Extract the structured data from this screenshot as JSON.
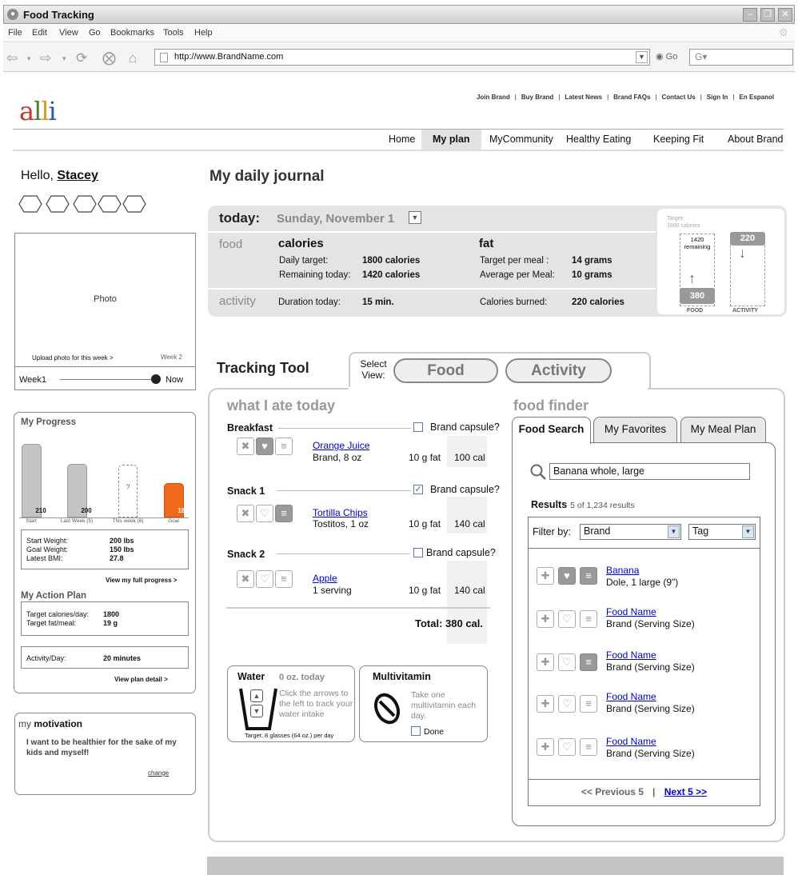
{
  "window": {
    "title": "Food Tracking"
  },
  "menu": [
    "File",
    "Edit",
    "View",
    "Go",
    "Bookmarks",
    "Tools",
    "Help"
  ],
  "browser": {
    "url": "http://www.BrandName.com",
    "go_label": "Go"
  },
  "header": {
    "logo": {
      "a": "a",
      "l1": "l",
      "l2": "l",
      "i": "i"
    },
    "top_links": [
      "Join Brand",
      "Buy Brand",
      "Latest News",
      "Brand FAQs",
      "Contact Us",
      "Sign In",
      "En Espanol"
    ],
    "nav": [
      "Home",
      "My plan",
      "MyCommunity",
      "Healthy Eating",
      "Keeping Fit",
      "About Brand"
    ]
  },
  "user": {
    "greeting": "Hello,",
    "name": "Stacey"
  },
  "photo": {
    "label": "Photo",
    "upload": "Upload photo for this week >",
    "week_end": "Week 2",
    "slider_start": "Week1",
    "slider_end": "Now",
    "slider_position": 1.0
  },
  "progress": {
    "title": "My Progress",
    "bars": [
      {
        "value": "210",
        "caption": "Start"
      },
      {
        "value": "200",
        "caption": "Last Week (5)"
      },
      {
        "value": "?",
        "caption": "This week (6)"
      },
      {
        "value": "180",
        "caption": "Goal"
      }
    ],
    "stats": [
      {
        "label": "Start Weight:",
        "value": "200 lbs"
      },
      {
        "label": "Goal Weight:",
        "value": "150 lbs"
      },
      {
        "label": "Latest BMI:",
        "value": "27.8"
      }
    ],
    "full_link": "View my full progress >",
    "action_title": "My Action Plan",
    "action": [
      {
        "label": "Target calories/day:",
        "value": "1800"
      },
      {
        "label": "Target fat/meal:",
        "value": "19 g"
      }
    ],
    "activity": {
      "label": "Activity/Day:",
      "value": "20 minutes"
    },
    "plan_link": "View plan detail >"
  },
  "motivation": {
    "title_pre": "my",
    "title_bold": "motivation",
    "quote": "I want to be healthier for the sake of my kids and myself!",
    "change": "change"
  },
  "journal": {
    "title": "My daily journal",
    "today_label": "today:",
    "date": "Sunday, November 1",
    "food_label": "food",
    "calories_head": "calories",
    "daily_target_label": "Daily target:",
    "daily_target": "1800 calories",
    "remaining_label": "Remaining today:",
    "remaining": "1420 calories",
    "fat_head": "fat",
    "fat_target_label": "Target per meal :",
    "fat_target": "14 grams",
    "fat_avg_label": "Average per Meal:",
    "fat_avg": "10 grams",
    "activity_label": "activity",
    "duration_label": "Duration today:",
    "duration": "15 min.",
    "burned_label": "Calories burned:",
    "burned": "220 calories"
  },
  "gauge": {
    "target_l1": "Target:",
    "target_l2": "1800 calories",
    "remaining_num": "1420",
    "remaining_txt": "remaining",
    "activity_value": "220",
    "food_value": "380",
    "food_caption": "FOOD",
    "activity_caption": "ACTIVITY"
  },
  "tracking": {
    "title": "Tracking Tool",
    "select_view": "Select View:",
    "view_food": "Food",
    "view_activity": "Activity",
    "ate_title": "what I ate today",
    "capsule_label": "Brand capsule?",
    "meals": [
      {
        "name": "Breakfast",
        "capsule": false,
        "food": "Orange Juice",
        "detail": "Brand, 8 oz",
        "fat": "10 g fat",
        "cal": "100 cal"
      },
      {
        "name": "Snack 1",
        "capsule": true,
        "food": "Tortilla Chips",
        "detail": "Tostitos, 1 oz",
        "fat": "10 g fat",
        "cal": "140 cal"
      },
      {
        "name": "Snack 2",
        "capsule": false,
        "food": "Apple",
        "detail": "1 serving",
        "fat": "10 g fat",
        "cal": "140 cal"
      }
    ],
    "total": "Total:  380 cal.",
    "water": {
      "title": "Water",
      "amount": "0 oz. today",
      "desc": "Click the arrows to the left to track your water intake",
      "target": "Target:  8 glasses (64 oz.) per day"
    },
    "vitamin": {
      "title": "Multivitamin",
      "desc": "Take one multivitamin each day.",
      "done": "Done"
    }
  },
  "finder": {
    "title": "food finder",
    "tabs": [
      "Food Search",
      "My Favorites",
      "My Meal Plan"
    ],
    "search_value": "Banana whole, large",
    "results_label": "Results",
    "results_count": "5 of 1,234 results",
    "filter_label": "Filter by:",
    "filter_brand": "Brand",
    "filter_tag": "Tag",
    "items": [
      {
        "name": "Banana",
        "detail": "Dole, 1 large (9\")"
      },
      {
        "name": "Food Name",
        "detail": "Brand (Serving Size)"
      },
      {
        "name": "Food Name",
        "detail": "Brand (Serving Size)"
      },
      {
        "name": "Food Name",
        "detail": "Brand (Serving Size)"
      },
      {
        "name": "Food Name",
        "detail": "Brand (Serving Size)"
      }
    ],
    "prev": "<< Previous 5",
    "sep": "|",
    "next": "Next 5 >>"
  }
}
